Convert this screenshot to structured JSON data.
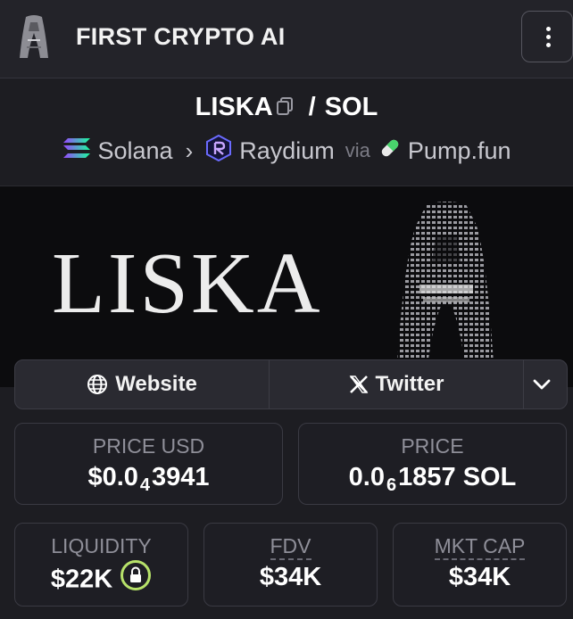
{
  "header": {
    "title": "FIRST CRYPTO AI",
    "menu_icon": "more-vertical-icon"
  },
  "pair": {
    "base": "LISKA",
    "separator": "/",
    "quote": "SOL"
  },
  "route": {
    "chain": "Solana",
    "dex": "Raydium",
    "via_label": "via",
    "launchpad": "Pump.fun"
  },
  "banner": {
    "text": "LISKA"
  },
  "links": {
    "website_label": "Website",
    "twitter_label": "Twitter"
  },
  "stats": {
    "price_usd": {
      "label": "PRICE USD",
      "prefix": "$0.0",
      "zeros": "4",
      "digits": "3941"
    },
    "price_sol": {
      "label": "PRICE",
      "prefix": "0.0",
      "zeros": "6",
      "digits": "1857 SOL"
    },
    "liquidity": {
      "label": "LIQUIDITY",
      "value": "$22K"
    },
    "fdv": {
      "label": "FDV",
      "value": "$34K"
    },
    "mkt_cap": {
      "label": "MKT CAP",
      "value": "$34K"
    }
  },
  "colors": {
    "background": "#1d1d22",
    "header": "#232329",
    "lock_ring": "#b7e26a"
  }
}
